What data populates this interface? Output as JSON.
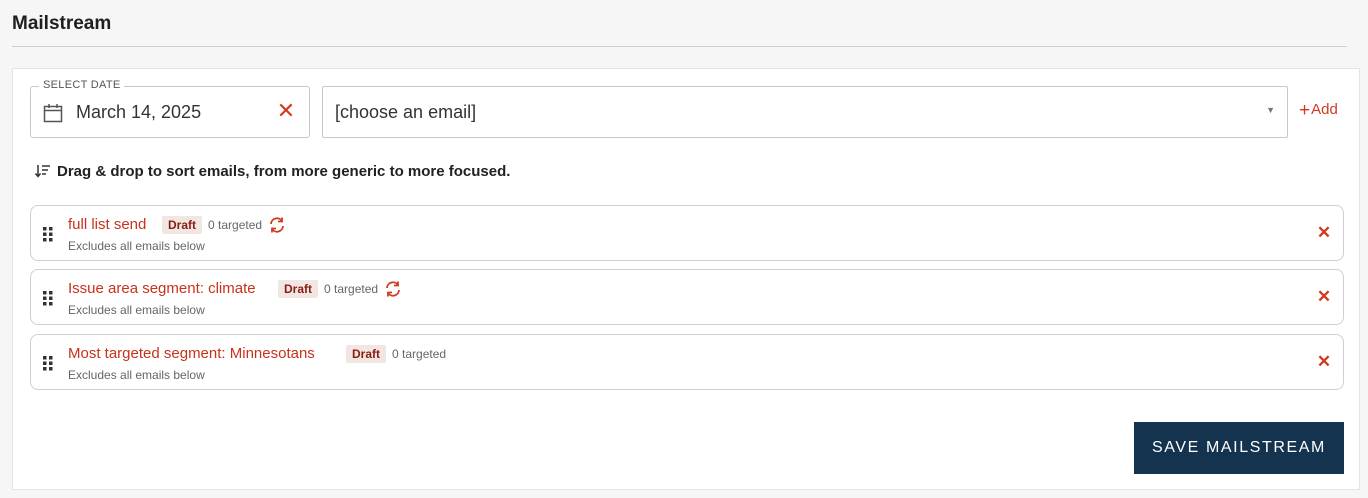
{
  "page": {
    "title": "Mailstream"
  },
  "date_field": {
    "legend": "SELECT DATE",
    "value": "March 14, 2025",
    "clear_glyph": "✕",
    "icon": "calendar-icon"
  },
  "email_select": {
    "placeholder": "[choose an email]",
    "arrow_glyph": "▼"
  },
  "add_link": {
    "plus": "+",
    "label": "Add"
  },
  "hint": {
    "text": "Drag & drop to sort emails, from more generic to more focused.",
    "icon": "sort-icon"
  },
  "emails": [
    {
      "title": "full list send",
      "badge": "Draft",
      "targeted": "0 targeted",
      "subtitle": "Excludes all emails below",
      "remove": "✕",
      "has_refresh": true
    },
    {
      "title": "Issue area segment: climate",
      "badge": "Draft",
      "targeted": "0 targeted",
      "subtitle": "Excludes all emails below",
      "remove": "✕",
      "has_refresh": true
    },
    {
      "title": "Most targeted segment: Minnesotans",
      "badge": "Draft",
      "targeted": "0 targeted",
      "subtitle": "Excludes all emails below",
      "remove": "✕",
      "has_refresh": false
    }
  ],
  "save_button": {
    "label": "SAVE MAILSTREAM"
  },
  "colors": {
    "accent": "#d13a1f",
    "link": "#c8321b",
    "primary_button": "#14334f",
    "badge_bg": "#f2e6e2",
    "badge_text": "#8a1d12"
  }
}
